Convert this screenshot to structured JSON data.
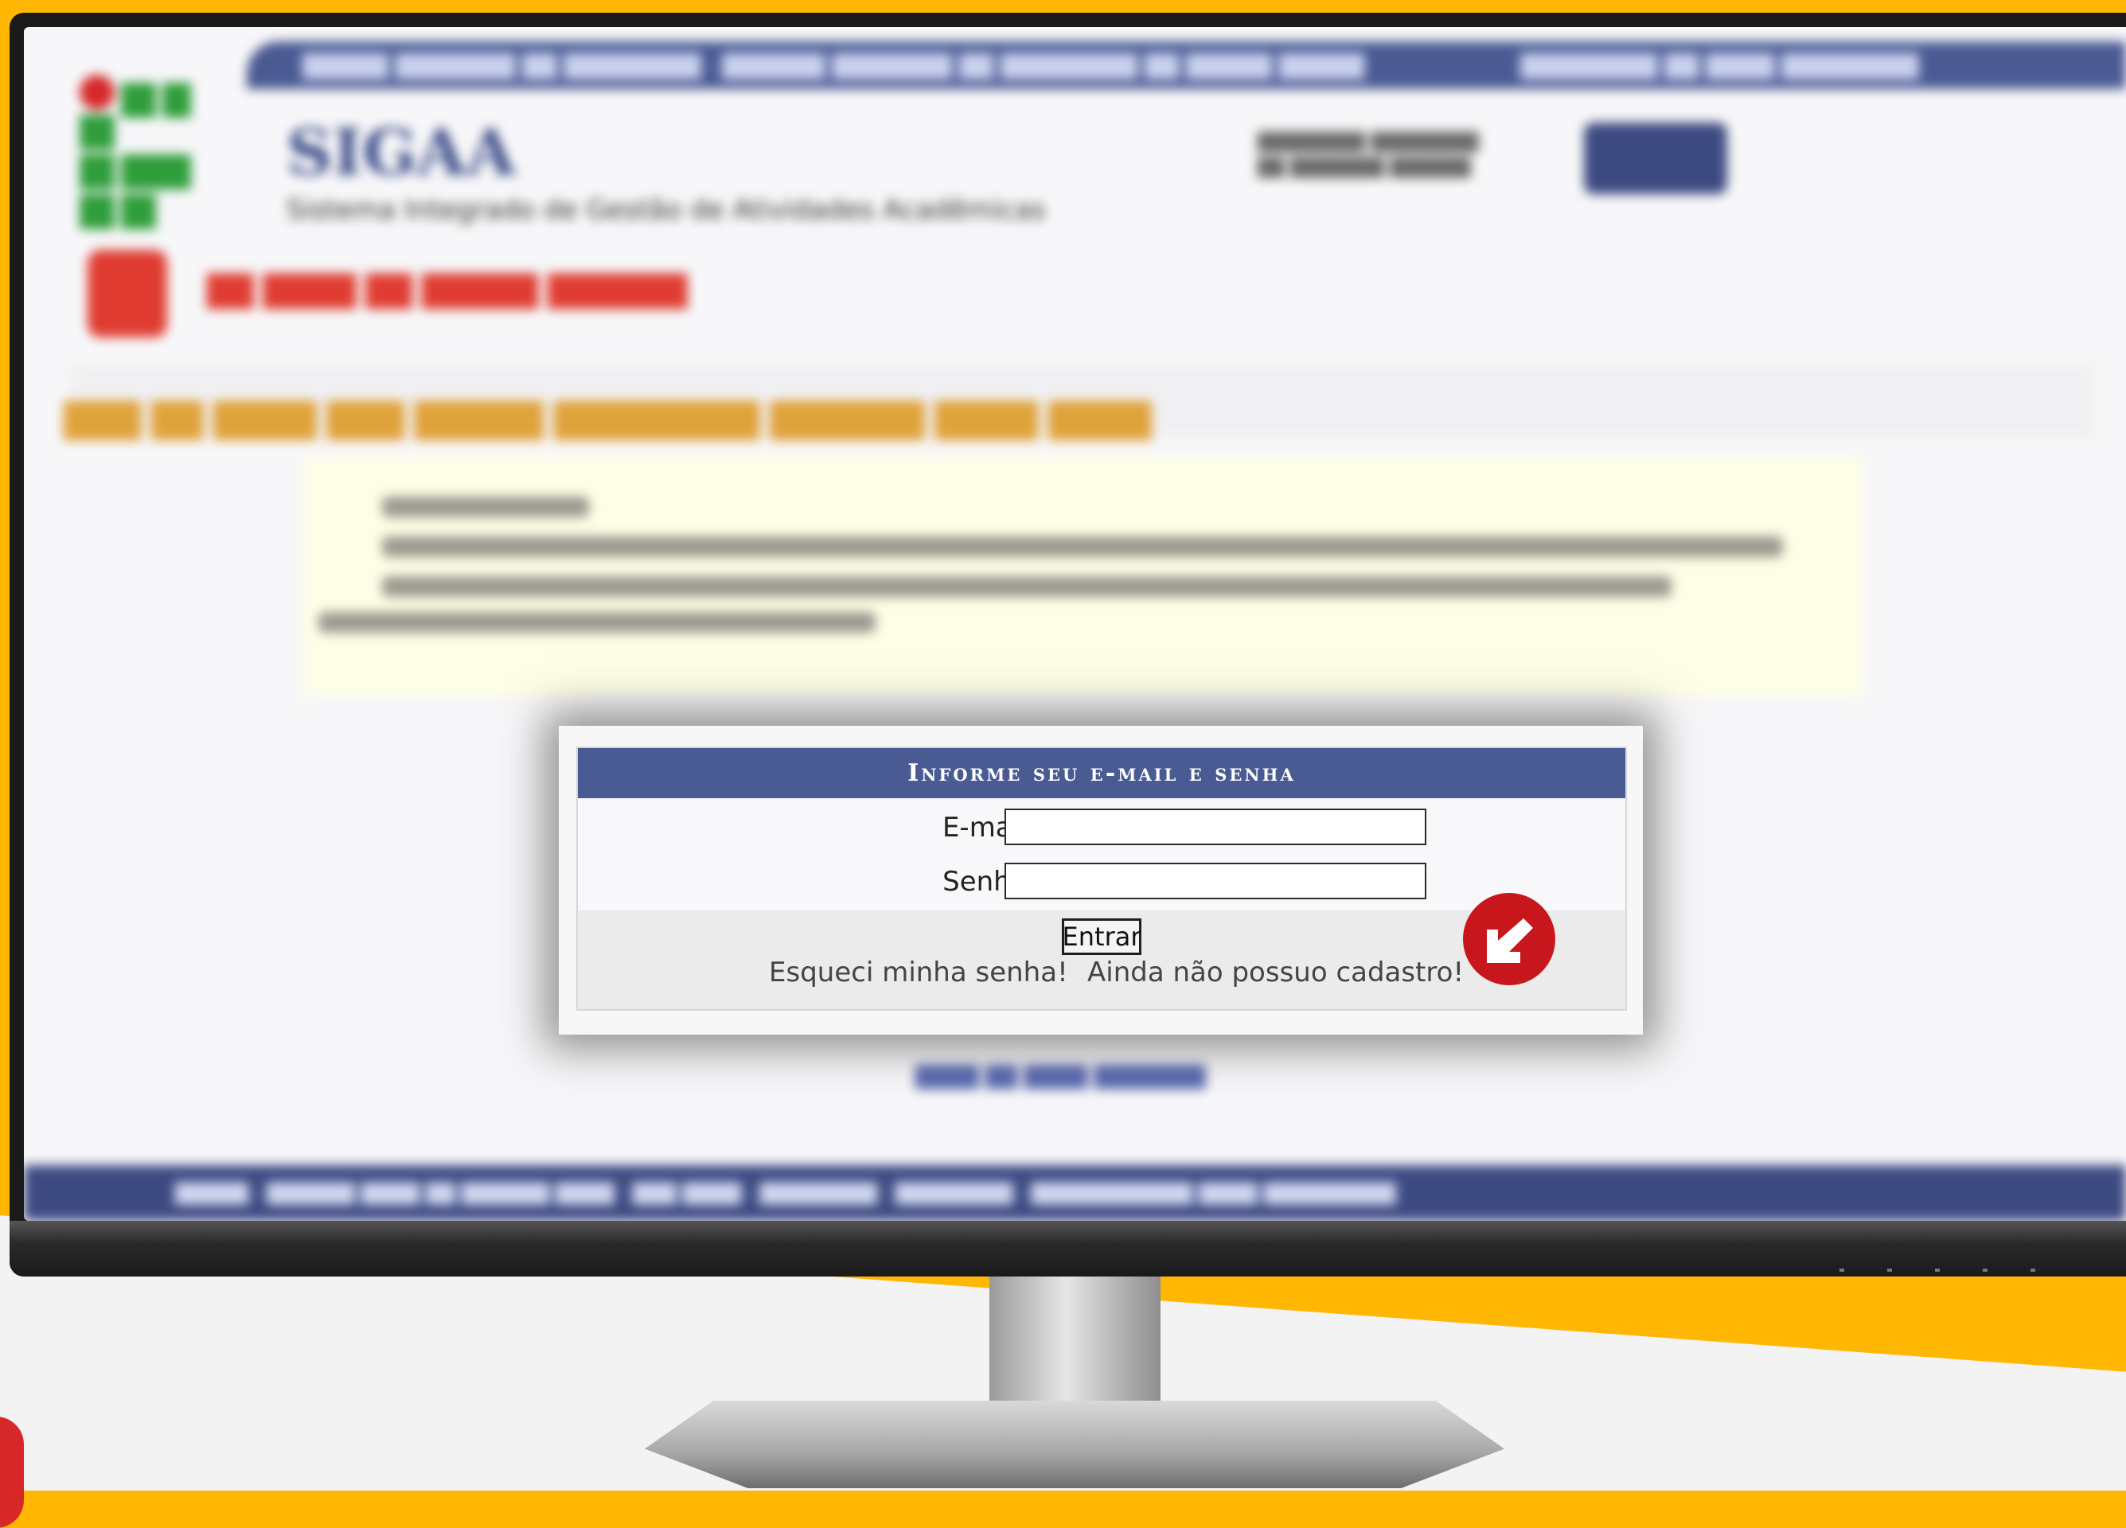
{
  "blurred_page": {
    "app_name": "SIGAA",
    "app_subtitle": "Sistema Integrado de Gestão de Atividades Acadêmicas"
  },
  "login": {
    "title": "Informe seu e-mail e senha",
    "email_label": "E-mail:",
    "email_value": "",
    "password_label": "Senha:",
    "password_value": "",
    "submit_label": "Entrar",
    "forgot_link": "Esqueci minha senha!",
    "register_link": "Ainda não possuo cadastro!"
  },
  "icons": {
    "arrow_badge": "arrow-down-left-icon"
  },
  "colors": {
    "background": "#ffb703",
    "header_blue": "#4a5a93",
    "badge_red": "#c8161d",
    "logo_green": "#2e9d3a"
  }
}
